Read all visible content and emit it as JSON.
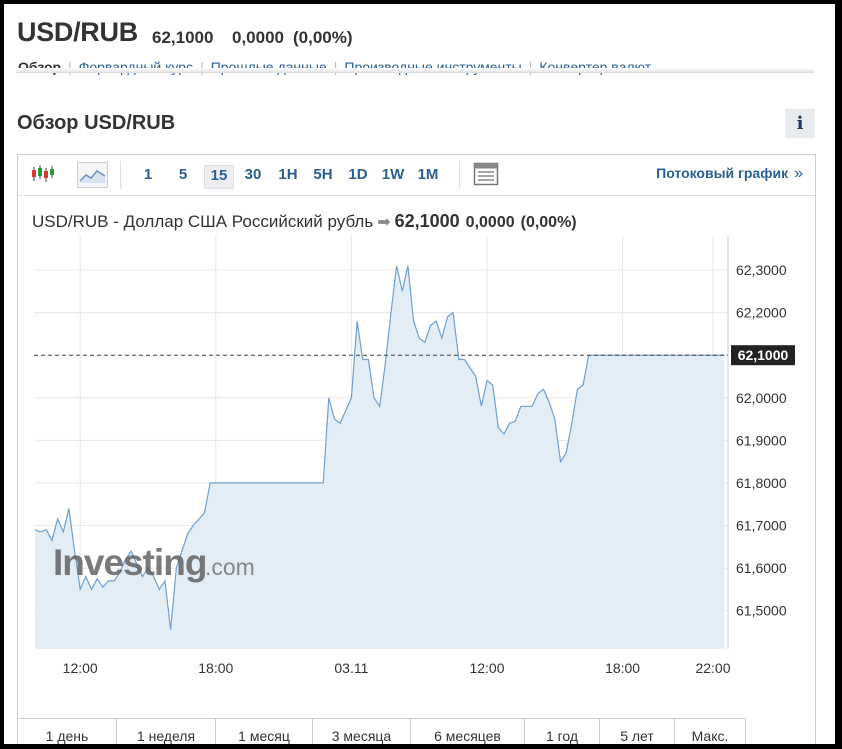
{
  "header": {
    "pair": "USD/RUB",
    "price": "62,1000",
    "change": "0,0000",
    "change_pct": "(0,00%)"
  },
  "subnav": {
    "items": [
      {
        "label": "Обзор",
        "active": true
      },
      {
        "label": "Форвардный курс"
      },
      {
        "label": "Прошлые данные"
      },
      {
        "label": "Производные инструменты"
      },
      {
        "label": "Конвертер валют"
      }
    ]
  },
  "section": {
    "title": "Обзор USD/RUB",
    "info_icon": "i"
  },
  "toolbar": {
    "chart_icons": [
      "candlestick-icon",
      "area-chart-icon"
    ],
    "intervals": [
      "1",
      "5",
      "15",
      "30",
      "1H",
      "5H",
      "1D",
      "1W",
      "1M"
    ],
    "active_interval": "15",
    "settings_icon": "chart-settings-icon",
    "stream_link": "Потоковый график",
    "stream_arrow": "»"
  },
  "chart_header": {
    "name": "USD/RUB - Доллар США Российский рубль",
    "arrow": "➡",
    "price": "62,1000",
    "change": "0,0000",
    "change_pct": "(0,00%)"
  },
  "watermark": {
    "brand": "Investing",
    "suffix": ".com"
  },
  "chart_data": {
    "type": "area",
    "ylim": [
      61.41,
      62.34
    ],
    "y_ticks": [
      {
        "value": 62.3,
        "label": "62,3000"
      },
      {
        "value": 62.2,
        "label": "62,2000"
      },
      {
        "value": 62.0,
        "label": "62,0000"
      },
      {
        "value": 61.9,
        "label": "61,9000"
      },
      {
        "value": 61.8,
        "label": "61,8000"
      },
      {
        "value": 61.7,
        "label": "61,7000"
      },
      {
        "value": 61.6,
        "label": "61,6000"
      },
      {
        "value": 61.5,
        "label": "61,5000"
      }
    ],
    "x_ticks": [
      {
        "index": 8,
        "label": "12:00"
      },
      {
        "index": 32,
        "label": "18:00"
      },
      {
        "index": 56,
        "label": "03.11"
      },
      {
        "index": 80,
        "label": "12:00"
      },
      {
        "index": 104,
        "label": "18:00"
      },
      {
        "index": 120,
        "label": "22:00"
      }
    ],
    "current": {
      "value": 62.1,
      "label": "62,1000"
    },
    "colors": {
      "line": "#6fa1cc",
      "fill": "#e3edf6",
      "grid": "#e8e8e8",
      "current_bg": "#222222"
    },
    "values": [
      61.69,
      61.685,
      61.69,
      61.665,
      61.715,
      61.685,
      61.74,
      61.64,
      61.55,
      61.58,
      61.55,
      61.575,
      61.555,
      61.57,
      61.57,
      61.59,
      61.62,
      61.64,
      61.61,
      61.58,
      61.6,
      61.58,
      61.55,
      61.57,
      61.455,
      61.6,
      61.64,
      61.68,
      61.7,
      61.715,
      61.73,
      61.8,
      61.8,
      61.8,
      61.8,
      61.8,
      61.8,
      61.8,
      61.8,
      61.8,
      61.8,
      61.8,
      61.8,
      61.8,
      61.8,
      61.8,
      61.8,
      61.8,
      61.8,
      61.8,
      61.8,
      61.8,
      62.0,
      61.95,
      61.94,
      61.97,
      62.0,
      62.18,
      62.09,
      62.09,
      62.0,
      61.98,
      62.08,
      62.2,
      62.31,
      62.25,
      62.31,
      62.18,
      62.14,
      62.13,
      62.17,
      62.18,
      62.14,
      62.19,
      62.2,
      62.09,
      62.09,
      62.07,
      62.05,
      61.98,
      62.04,
      62.03,
      61.93,
      61.915,
      61.94,
      61.945,
      61.98,
      61.98,
      61.98,
      62.01,
      62.02,
      61.99,
      61.95,
      61.85,
      61.87,
      61.94,
      62.02,
      62.03,
      62.1,
      62.1,
      62.1,
      62.1,
      62.1,
      62.1,
      62.1,
      62.1,
      62.1,
      62.1,
      62.1,
      62.1,
      62.1,
      62.1,
      62.1,
      62.1,
      62.1,
      62.1,
      62.1,
      62.1,
      62.1,
      62.1,
      62.1,
      62.1,
      62.1
    ]
  },
  "ranges": [
    {
      "label": "1 день"
    },
    {
      "label": "1 неделя"
    },
    {
      "label": "1 месяц"
    },
    {
      "label": "3 месяца"
    },
    {
      "label": "6 месяцев"
    },
    {
      "label": "1 год"
    },
    {
      "label": "5 лет"
    },
    {
      "label": "Макс."
    }
  ]
}
